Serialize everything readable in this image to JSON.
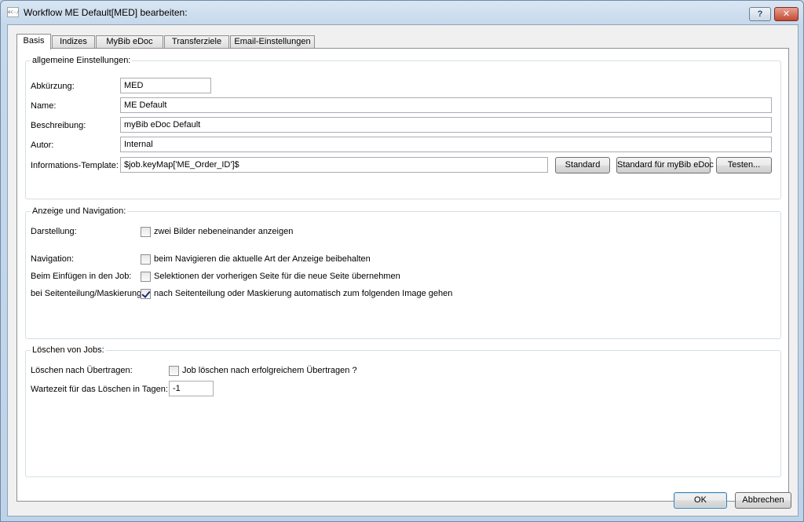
{
  "window": {
    "title": "Workflow ME Default[MED] bearbeiten:",
    "icon_text": "ec-/",
    "help_label": "?",
    "close_label": "✕"
  },
  "tabs": [
    "Basis",
    "Indizes",
    "MyBib eDoc",
    "Transferziele",
    "Email-Einstellungen"
  ],
  "general": {
    "title": "allgemeine Einstellungen:",
    "abbr_label": "Abkürzung:",
    "abbr_value": "MED",
    "name_label": "Name:",
    "name_value": "ME Default",
    "desc_label": "Beschreibung:",
    "desc_value": "myBib eDoc Default",
    "author_label": "Autor:",
    "author_value": "Internal",
    "template_label": "Informations-Template:",
    "template_value": "$job.keyMap['ME_Order_ID']$",
    "btn_standard": "Standard",
    "btn_standard_mybib": "Standard für myBib eDoc",
    "btn_test": "Testen..."
  },
  "display": {
    "title": "Anzeige und Navigation:",
    "darstellung_label": "Darstellung:",
    "darstellung_cb": "zwei Bilder nebeneinander anzeigen",
    "darstellung_checked": false,
    "navigation_label": "Navigation:",
    "navigation_cb": "beim Navigieren die aktuelle Art der Anzeige beibehalten",
    "navigation_checked": false,
    "insert_label": "Beim Einfügen in den Job:",
    "insert_cb": "Selektionen der vorherigen Seite für die neue Seite übernehmen",
    "insert_checked": false,
    "split_label": "bei Seitenteilung/Maskierung",
    "split_cb": "nach Seitenteilung oder Maskierung automatisch zum folgenden Image gehen",
    "split_checked": true
  },
  "delete": {
    "title": "Löschen von Jobs:",
    "after_transfer_label": "Löschen nach Übertragen:",
    "after_transfer_cb": "Job löschen nach erfolgreichem Übertragen ?",
    "after_transfer_checked": false,
    "wait_label": "Wartezeit für das Löschen in Tagen:",
    "wait_value": "-1"
  },
  "footer": {
    "ok": "OK",
    "cancel": "Abbrechen"
  }
}
